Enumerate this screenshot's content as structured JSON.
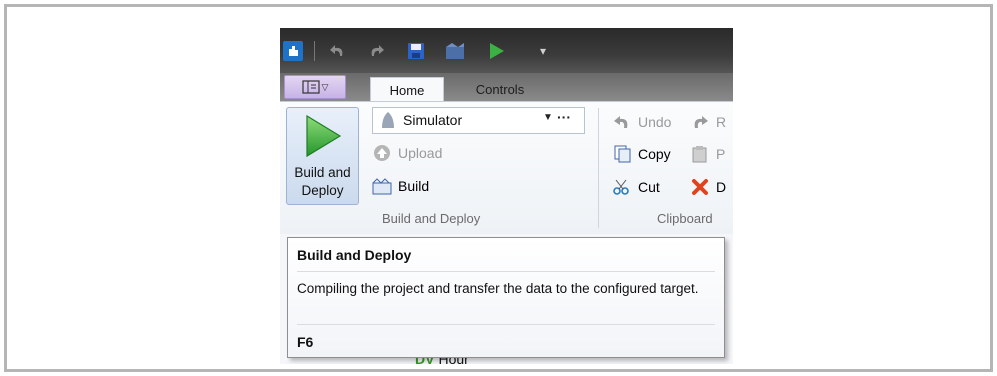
{
  "quick_access": {
    "icons": [
      "app-icon",
      "undo-icon",
      "redo-icon",
      "save-icon",
      "build-icon",
      "play-icon",
      "customize-dropdown-icon"
    ]
  },
  "tabs": [
    {
      "label": "Home",
      "active": true
    },
    {
      "label": "Controls",
      "active": false
    }
  ],
  "ribbon": {
    "build_and_deploy_button": "Build and Deploy",
    "target_dropdown": {
      "value": "Simulator",
      "more": "···"
    },
    "upload_label": "Upload",
    "build_label": "Build",
    "group_build_label": "Build and Deploy",
    "clipboard": {
      "undo_label": "Undo",
      "redo_label": "R",
      "copy_label": "Copy",
      "paste_label": "P",
      "cut_label": "Cut",
      "delete_label": "D",
      "group_label": "Clipboard"
    }
  },
  "tooltip": {
    "title": "Build and Deploy",
    "description": "Compiling the project and transfer the data to the configured target.",
    "shortcut": "F6"
  },
  "background_partial": {
    "prefix": "DV",
    "text": "Hour"
  },
  "colors": {
    "accent_green": "#3cb043",
    "tooltip_border": "#8e8e8e"
  }
}
